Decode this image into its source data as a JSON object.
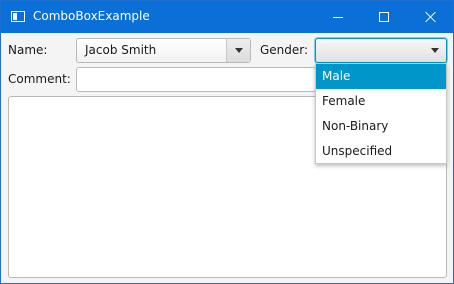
{
  "window": {
    "title": "ComboBoxExample",
    "title_bar_color": "#0a6fd6",
    "app_icon": "window-app-icon",
    "controls": [
      "minimize-icon",
      "maximize-icon",
      "close-icon"
    ]
  },
  "form": {
    "name_label": "Name:",
    "name_value": "Jacob Smith",
    "gender_label": "Gender:",
    "gender_value": "",
    "comment_label": "Comment:",
    "comment_value": "",
    "notes_value": ""
  },
  "gender_dropdown": {
    "open": true,
    "highlight_color": "#0096c9",
    "options": [
      {
        "label": "Male",
        "selected": true
      },
      {
        "label": "Female",
        "selected": false
      },
      {
        "label": "Non-Binary",
        "selected": false
      },
      {
        "label": "Unspecified",
        "selected": false
      }
    ]
  }
}
